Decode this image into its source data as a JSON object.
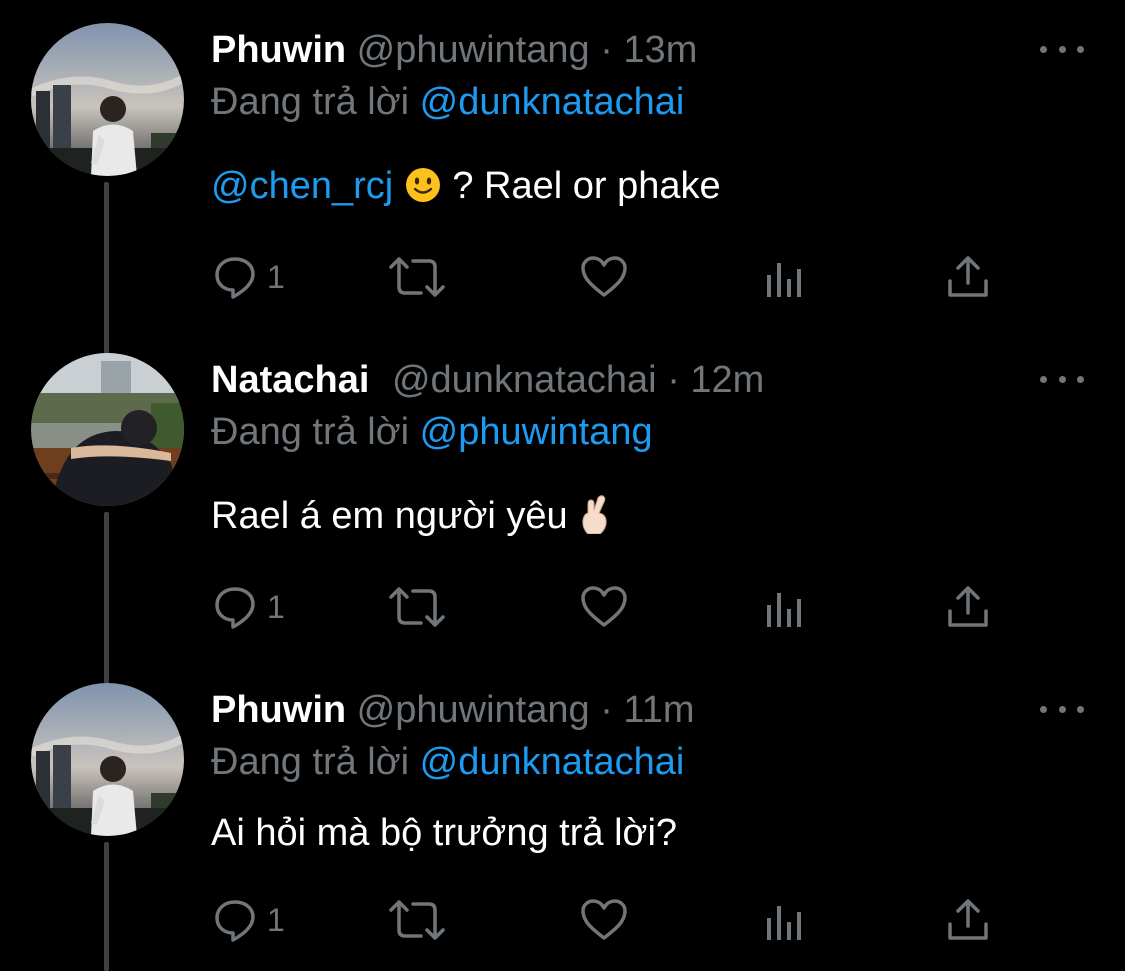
{
  "colors": {
    "background": "#000000",
    "text": "#ffffff",
    "muted": "#71767b",
    "accent": "#1d9bf0",
    "thread_line": "#3e4144"
  },
  "tweets": [
    {
      "name": "Phuwin",
      "handle": "@phuwintang",
      "separator": "·",
      "time": "13m",
      "reply_prefix": "Đang trả lời",
      "reply_to": "@dunknatachai",
      "mention": "@chen_rcj",
      "emoji": "slightly-smiling-face-icon",
      "text": "? Rael or phake",
      "reply_count": "1"
    },
    {
      "name": "Natachai",
      "handle": "@dunknatachai",
      "separator": "·",
      "time": "12m",
      "reply_prefix": "Đang trả lời",
      "reply_to": "@phuwintang",
      "text": "Rael á em người yêu",
      "emoji": "crossed-fingers-icon",
      "reply_count": "1"
    },
    {
      "name": "Phuwin",
      "handle": "@phuwintang",
      "separator": "·",
      "time": "11m",
      "reply_prefix": "Đang trả lời",
      "reply_to": "@dunknatachai",
      "text": "Ai hỏi mà bộ trưởng trả lời?",
      "reply_count": "1"
    }
  ],
  "icons": {
    "reply": "reply-icon",
    "retweet": "retweet-icon",
    "like": "heart-icon",
    "views": "analytics-icon",
    "share": "share-icon",
    "more": "more-options-icon"
  }
}
